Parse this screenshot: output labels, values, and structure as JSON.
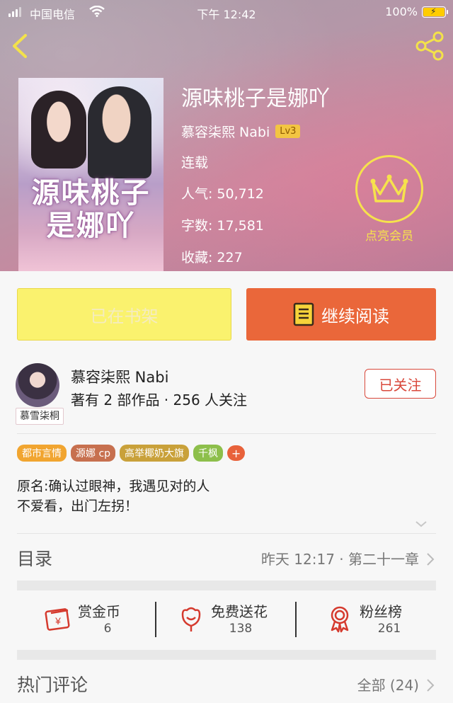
{
  "status_bar": {
    "carrier": "中国电信",
    "time": "下午 12:42",
    "battery_percent": "100%"
  },
  "nav": {
    "back_icon": "chevron-left-icon",
    "share_icon": "share-icon"
  },
  "book": {
    "cover_title": "源味桃子是娜吖",
    "title": "源味桃子是娜吖",
    "author": "慕容柒熙 Nabi",
    "author_level": "Lv3",
    "status": "连载",
    "popularity_label": "人气:",
    "popularity": "50,712",
    "word_count_label": "字数:",
    "word_count": "17,581",
    "favorites_label": "收藏:",
    "favorites": "227"
  },
  "vip": {
    "icon": "crown-icon",
    "label": "点亮会员"
  },
  "actions": {
    "shelf_label": "已在书架",
    "read_label": "继续阅读",
    "read_icon": "book-icon"
  },
  "author_card": {
    "name": "慕容柒熙 Nabi",
    "info": "著有 2 部作品 · 256 人关注",
    "avatar_tag": "慕雪柒桐",
    "follow_label": "已关注"
  },
  "tags": [
    {
      "label": "都市言情",
      "color": "#f1a530"
    },
    {
      "label": "源娜 cp",
      "color": "#c7704f"
    },
    {
      "label": "高举椰奶大旗",
      "color": "#c9a13a"
    },
    {
      "label": "千枫",
      "color": "#8dbf4b"
    }
  ],
  "tag_add_label": "+",
  "synopsis": {
    "line1": "原名:确认过眼神，我遇见对的人",
    "line2": "不爱看，出门左拐！"
  },
  "toc": {
    "label": "目录",
    "latest": "昨天 12:17 · 第二十一章"
  },
  "stats": [
    {
      "name": "赏金币",
      "value": "6",
      "icon": "reward-coin-icon"
    },
    {
      "name": "免费送花",
      "value": "138",
      "icon": "flower-icon"
    },
    {
      "name": "粉丝榜",
      "value": "261",
      "icon": "medal-icon"
    }
  ],
  "comments": {
    "title": "热门评论",
    "all_label": "全部 (24)"
  },
  "colors": {
    "accent": "#ea673a",
    "shelf_button": "#faf26e",
    "follow": "#d9483b",
    "vip": "#f6e24c",
    "level_badge": "#f3c542"
  }
}
